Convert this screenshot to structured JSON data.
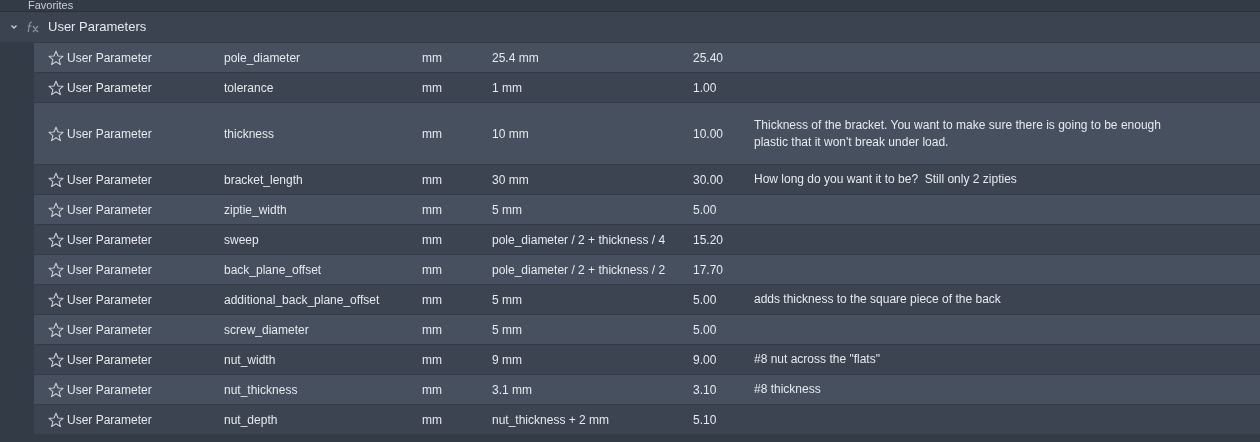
{
  "favorites_label": "Favorites",
  "group": {
    "title": "User Parameters",
    "expanded": true,
    "rows": [
      {
        "favorite": false,
        "type": "User Parameter",
        "name": "pole_diameter",
        "unit": "mm",
        "expression": "25.4 mm",
        "value": "25.40",
        "comment": ""
      },
      {
        "favorite": false,
        "type": "User Parameter",
        "name": "tolerance",
        "unit": "mm",
        "expression": "1 mm",
        "value": "1.00",
        "comment": ""
      },
      {
        "favorite": false,
        "type": "User Parameter",
        "name": "thickness",
        "unit": "mm",
        "expression": "10 mm",
        "value": "10.00",
        "comment": "Thickness of the bracket. You want to make sure there is going to be enough plastic that it won't break under load."
      },
      {
        "favorite": false,
        "type": "User Parameter",
        "name": "bracket_length",
        "unit": "mm",
        "expression": "30 mm",
        "value": "30.00",
        "comment": "How long do you want it to be?  Still only 2 zipties"
      },
      {
        "favorite": false,
        "type": "User Parameter",
        "name": "ziptie_width",
        "unit": "mm",
        "expression": "5 mm",
        "value": "5.00",
        "comment": ""
      },
      {
        "favorite": false,
        "type": "User Parameter",
        "name": "sweep",
        "unit": "mm",
        "expression": "pole_diameter / 2 + thickness / 4",
        "value": "15.20",
        "comment": ""
      },
      {
        "favorite": false,
        "type": "User Parameter",
        "name": "back_plane_offset",
        "unit": "mm",
        "expression": "pole_diameter / 2 + thickness / 2",
        "value": "17.70",
        "comment": ""
      },
      {
        "favorite": false,
        "type": "User Parameter",
        "name": "additional_back_plane_offset",
        "unit": "mm",
        "expression": "5 mm",
        "value": "5.00",
        "comment": "adds thickness to the square piece of the back"
      },
      {
        "favorite": false,
        "type": "User Parameter",
        "name": "screw_diameter",
        "unit": "mm",
        "expression": "5 mm",
        "value": "5.00",
        "comment": ""
      },
      {
        "favorite": false,
        "type": "User Parameter",
        "name": "nut_width",
        "unit": "mm",
        "expression": "9 mm",
        "value": "9.00",
        "comment": "#8 nut across the \"flats\""
      },
      {
        "favorite": false,
        "type": "User Parameter",
        "name": "nut_thickness",
        "unit": "mm",
        "expression": "3.1 mm",
        "value": "3.10",
        "comment": "#8 thickness"
      },
      {
        "favorite": false,
        "type": "User Parameter",
        "name": "nut_depth",
        "unit": "mm",
        "expression": "nut_thickness + 2 mm",
        "value": "5.10",
        "comment": ""
      }
    ]
  }
}
